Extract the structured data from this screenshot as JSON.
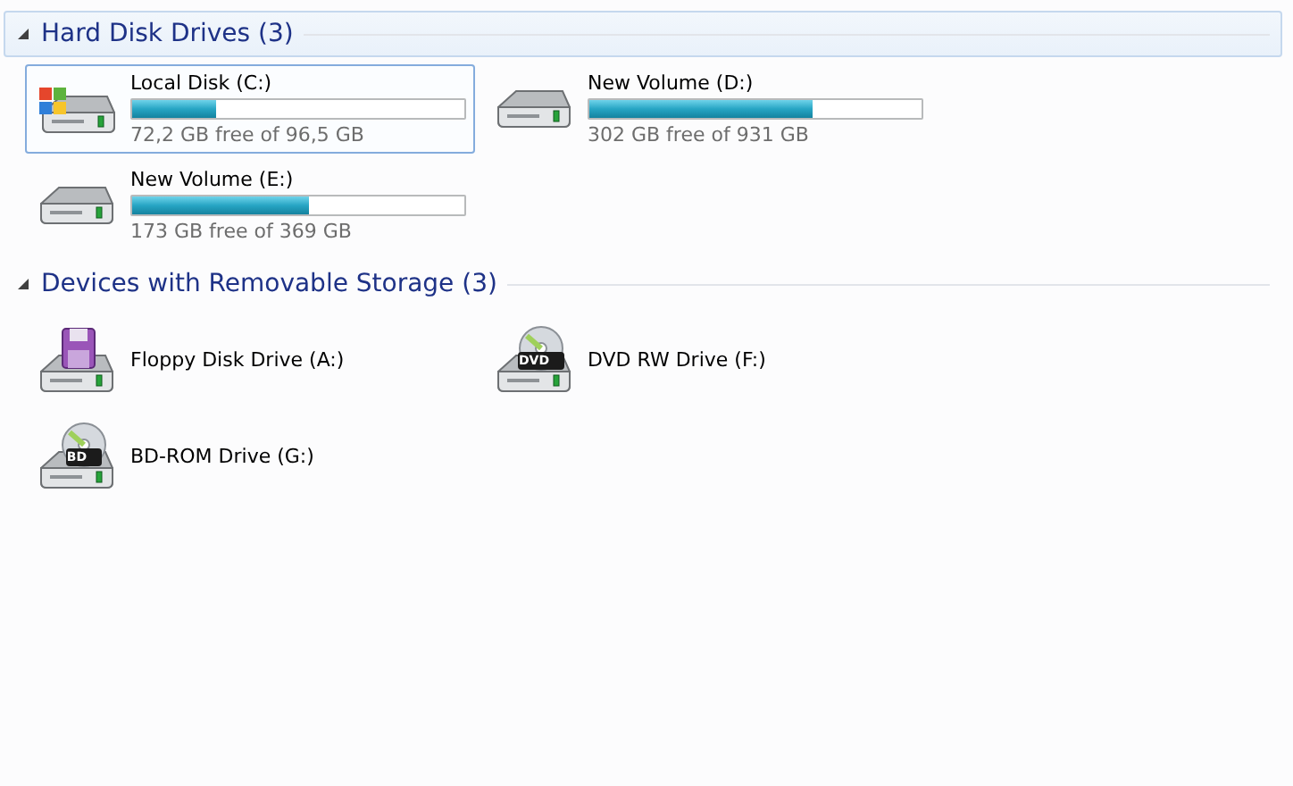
{
  "groups": [
    {
      "title": "Hard Disk Drives (3)",
      "expanded": true,
      "focused": true,
      "items": [
        {
          "kind": "disk",
          "label": "Local Disk (C:)",
          "system": true,
          "level": 0.25,
          "free": "72,2 GB free of 96,5 GB",
          "selected": true
        },
        {
          "kind": "disk",
          "label": "New Volume (D:)",
          "system": false,
          "level": 0.67,
          "free": "302 GB free of 931 GB",
          "selected": false
        },
        {
          "kind": "disk",
          "label": "New Volume (E:)",
          "system": false,
          "level": 0.53,
          "free": "173 GB free of 369 GB",
          "selected": false
        }
      ]
    },
    {
      "title": "Devices with Removable Storage (3)",
      "expanded": true,
      "focused": false,
      "items": [
        {
          "kind": "floppy",
          "label": "Floppy Disk Drive (A:)",
          "selected": false
        },
        {
          "kind": "optical",
          "label": "DVD RW Drive (F:)",
          "badge": "DVD",
          "selected": false
        },
        {
          "kind": "optical",
          "label": "BD-ROM Drive (G:)",
          "badge": "BD",
          "selected": false
        }
      ]
    }
  ]
}
